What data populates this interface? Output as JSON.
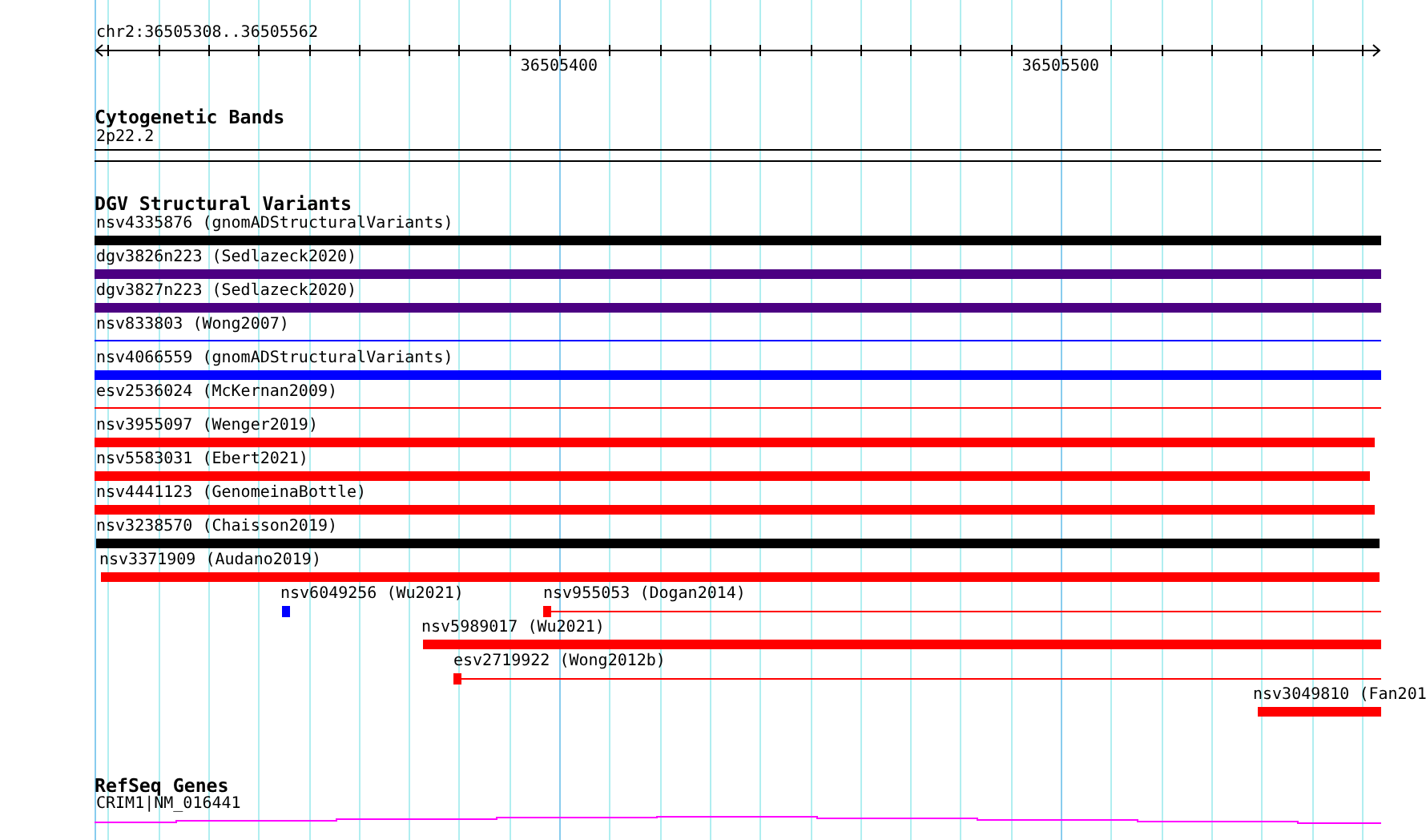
{
  "ruler": {
    "location": "chr2:36505308..36505562",
    "ticks": [
      "36505400",
      "36505500"
    ]
  },
  "tracks": [
    {
      "title": "Cytogenetic Bands",
      "kind": "bands",
      "features": [
        {
          "label": "2p22.2"
        }
      ]
    },
    {
      "title": "DGV Structural Variants",
      "kind": "variants",
      "features": [
        {
          "label": "nsv4335876 (gnomADStructuralVariants)",
          "kind": "bar",
          "color": "#000000"
        },
        {
          "label": "dgv3826n223 (Sedlazeck2020)",
          "kind": "bar",
          "color": "#4b0082"
        },
        {
          "label": "dgv3827n223 (Sedlazeck2020)",
          "kind": "bar",
          "color": "#4b0082"
        },
        {
          "label": "nsv833803 (Wong2007)",
          "kind": "line",
          "color": "#0000ff"
        },
        {
          "label": "nsv4066559 (gnomADStructuralVariants)",
          "kind": "bar",
          "color": "#0000ff"
        },
        {
          "label": "esv2536024 (McKernan2009)",
          "kind": "line",
          "color": "#ff0000"
        },
        {
          "label": "nsv3955097 (Wenger2019)",
          "kind": "bar",
          "color": "#ff0000"
        },
        {
          "label": "nsv5583031 (Ebert2021)",
          "kind": "bar",
          "color": "#ff0000"
        },
        {
          "label": "nsv4441123 (GenomeinaBottle)",
          "kind": "bar",
          "color": "#ff0000"
        },
        {
          "label": "nsv3238570 (Chaisson2019)",
          "kind": "bar",
          "color": "#000000"
        },
        {
          "label": "nsv3371909 (Audano2019)",
          "kind": "bar",
          "color": "#ff0000"
        },
        {
          "label": "nsv6049256 (Wu2021)",
          "kind": "box",
          "color": "#0000ff"
        },
        {
          "label": "nsv955053 (Dogan2014)",
          "kind": "box-line",
          "color": "#ff0000"
        },
        {
          "label": "nsv5989017 (Wu2021)",
          "kind": "bar",
          "color": "#ff0000"
        },
        {
          "label": "esv2719922 (Wong2012b)",
          "kind": "box-line",
          "color": "#ff0000"
        },
        {
          "label": "nsv3049810 (Fan201",
          "kind": "bar",
          "color": "#ff0000"
        }
      ]
    },
    {
      "title": "RefSeq Genes",
      "kind": "genes",
      "features": [
        {
          "label": "CRIM1|NM_016441"
        }
      ]
    }
  ]
}
